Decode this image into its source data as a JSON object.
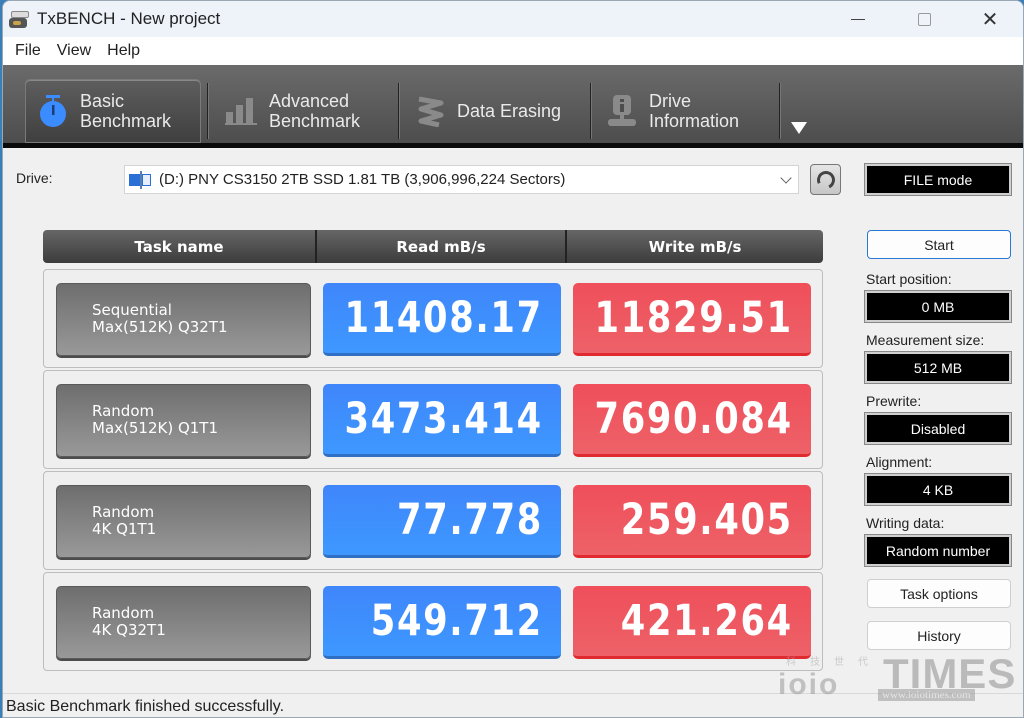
{
  "window": {
    "title": "TxBENCH - New project",
    "controls": {
      "minimize": "minimize",
      "maximize": "maximize",
      "close": "✕"
    }
  },
  "menu": [
    "File",
    "View",
    "Help"
  ],
  "tabs": [
    {
      "line1": "Basic",
      "line2": "Benchmark",
      "icon": "stopwatch-icon",
      "active": true
    },
    {
      "line1": "Advanced",
      "line2": "Benchmark",
      "icon": "bar-chart-icon",
      "active": false
    },
    {
      "line1": "Data Erasing",
      "line2": "",
      "icon": "eraser-icon",
      "active": false
    },
    {
      "line1": "Drive",
      "line2": "Information",
      "icon": "drive-info-icon",
      "active": false
    }
  ],
  "drive": {
    "label": "Drive:",
    "selected": "(D:) PNY CS3150 2TB SSD  1.81 TB (3,906,996,224 Sectors)"
  },
  "table": {
    "headers": {
      "task": "Task name",
      "read": "Read mB/s",
      "write": "Write mB/s"
    },
    "rows": [
      {
        "name1": "Sequential",
        "name2": "Max(512K) Q32T1",
        "read": "11408.17",
        "write": "11829.51"
      },
      {
        "name1": "Random",
        "name2": "Max(512K) Q1T1",
        "read": "3473.414",
        "write": "7690.084"
      },
      {
        "name1": "Random",
        "name2": "4K Q1T1",
        "read": "77.778",
        "write": "259.405"
      },
      {
        "name1": "Random",
        "name2": "4K Q32T1",
        "read": "549.712",
        "write": "421.264"
      }
    ]
  },
  "panel": {
    "mode": "FILE mode",
    "start_label": "Start",
    "start_position_label": "Start position:",
    "start_position": "0 MB",
    "measurement_size_label": "Measurement size:",
    "measurement_size": "512 MB",
    "prewrite_label": "Prewrite:",
    "prewrite": "Disabled",
    "alignment_label": "Alignment:",
    "alignment": "4 KB",
    "writing_data_label": "Writing data:",
    "writing_data": "Random number",
    "task_options_label": "Task options",
    "history_label": "History"
  },
  "status": "Basic Benchmark finished successfully.",
  "watermark": {
    "brand": "TIMES",
    "logo": "ioio",
    "chars": "科技世代",
    "url": "www.ioiotimes.com"
  },
  "colors": {
    "read": "#3f8cfd",
    "write": "#ee5860",
    "toolbar": "#5a5a5a"
  }
}
